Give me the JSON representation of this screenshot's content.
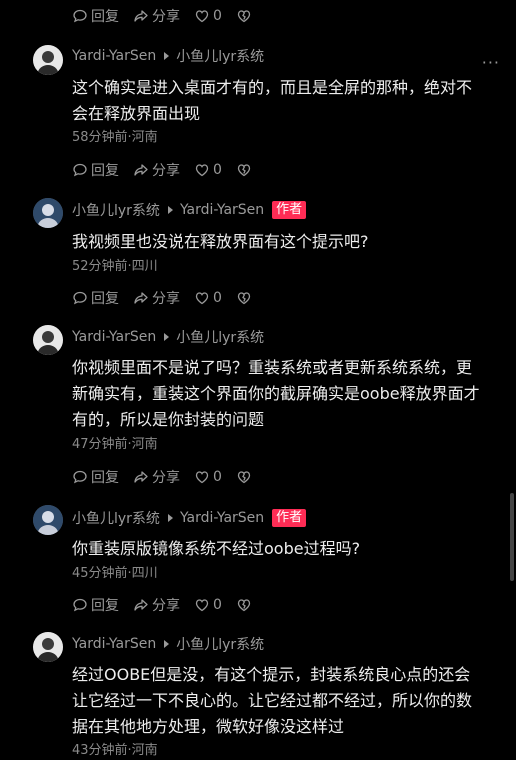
{
  "actions": {
    "reply": "回复",
    "share": "分享",
    "likes": "0"
  },
  "comments": [
    {
      "user": "Yardi-YarSen",
      "reply_to": "小鱼儿lyr系统",
      "badge": "",
      "text_lines": [
        "这个确实是进入桌面才有的，而且是全屏的那种，绝对不",
        "会在释放界面出现"
      ],
      "time": "58分钟前·河南"
    },
    {
      "user": "小鱼儿lyr系统",
      "reply_to": "Yardi-YarSen",
      "badge": "作者",
      "text_lines": [
        "我视频里也没说在释放界面有这个提示吧?"
      ],
      "time": "52分钟前·四川"
    },
    {
      "user": "Yardi-YarSen",
      "reply_to": "小鱼儿lyr系统",
      "badge": "",
      "text_lines": [
        "你视频里面不是说了吗？重装系统或者更新系统系统，更",
        "新确实有，重装这个界面你的截屏确实是oobe释放界面才",
        "有的，所以是你封装的问题"
      ],
      "time": "47分钟前·河南"
    },
    {
      "user": "小鱼儿lyr系统",
      "reply_to": "Yardi-YarSen",
      "badge": "作者",
      "text_lines": [
        "你重装原版镜像系统不经过oobe过程吗?"
      ],
      "time": "45分钟前·四川"
    },
    {
      "user": "Yardi-YarSen",
      "reply_to": "小鱼儿lyr系统",
      "badge": "",
      "text_lines": [
        "经过OOBE但是没，有这个提示，封装系统良心点的还会",
        "让它经过一下不良心的。让它经过都不经过，所以你的数",
        "据在其他地方处理，微软好像没这样过"
      ],
      "time": "43分钟前·河南"
    }
  ],
  "more_label": "···",
  "icons": {
    "reply": "comment-bubble-icon",
    "share": "share-arrow-icon",
    "like": "heart-icon",
    "dislike": "broken-heart-icon"
  }
}
